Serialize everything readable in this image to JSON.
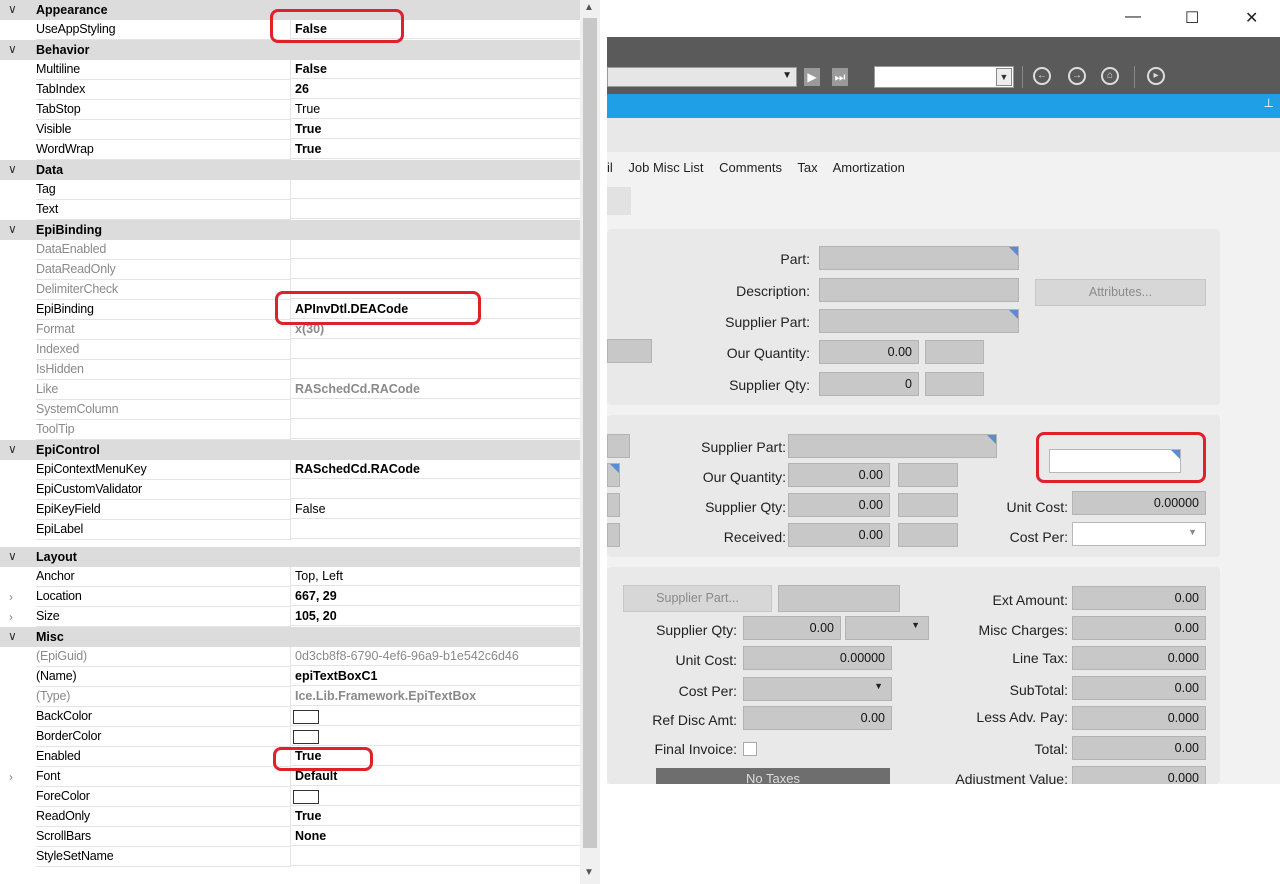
{
  "properties": {
    "appearance": {
      "label": "Appearance",
      "rows": [
        {
          "name": "UseAppStyling",
          "value": "False"
        }
      ]
    },
    "behavior": {
      "label": "Behavior",
      "rows": [
        {
          "name": "Multiline",
          "value": "False"
        },
        {
          "name": "TabIndex",
          "value": "26"
        },
        {
          "name": "TabStop",
          "value": "True"
        },
        {
          "name": "Visible",
          "value": "True"
        },
        {
          "name": "WordWrap",
          "value": "True"
        }
      ]
    },
    "data": {
      "label": "Data",
      "rows": [
        {
          "name": "Tag",
          "value": ""
        },
        {
          "name": "Text",
          "value": ""
        }
      ]
    },
    "epibinding": {
      "label": "EpiBinding",
      "rows": [
        {
          "name": "DataEnabled",
          "value": ""
        },
        {
          "name": "DataReadOnly",
          "value": ""
        },
        {
          "name": "DelimiterCheck",
          "value": ""
        },
        {
          "name": "EpiBinding",
          "value": "APInvDtl.DEACode"
        },
        {
          "name": "Format",
          "value": "x(30)"
        },
        {
          "name": "Indexed",
          "value": ""
        },
        {
          "name": "IsHidden",
          "value": ""
        },
        {
          "name": "Like",
          "value": "RASchedCd.RACode"
        },
        {
          "name": "SystemColumn",
          "value": ""
        },
        {
          "name": "ToolTip",
          "value": ""
        }
      ]
    },
    "epicontrol": {
      "label": "EpiControl",
      "rows": [
        {
          "name": "EpiContextMenuKey",
          "value": "RASchedCd.RACode"
        },
        {
          "name": "EpiCustomValidator",
          "value": ""
        },
        {
          "name": "EpiKeyField",
          "value": "False"
        },
        {
          "name": "EpiLabel",
          "value": ""
        }
      ]
    },
    "layout": {
      "label": "Layout",
      "rows": [
        {
          "name": "Anchor",
          "value": "Top, Left"
        },
        {
          "name": "Location",
          "value": "667, 29"
        },
        {
          "name": "Size",
          "value": "105, 20"
        }
      ]
    },
    "misc": {
      "label": "Misc",
      "rows": [
        {
          "name": "(EpiGuid)",
          "value": "0d3cb8f8-6790-4ef6-96a9-b1e542c6d46"
        },
        {
          "name": "(Name)",
          "value": "epiTextBoxC1"
        },
        {
          "name": "(Type)",
          "value": "Ice.Lib.Framework.EpiTextBox"
        },
        {
          "name": "BackColor",
          "value": ""
        },
        {
          "name": "BorderColor",
          "value": ""
        },
        {
          "name": "Enabled",
          "value": "True"
        },
        {
          "name": "Font",
          "value": "Default"
        },
        {
          "name": "ForeColor",
          "value": ""
        },
        {
          "name": "ReadOnly",
          "value": "True"
        },
        {
          "name": "ScrollBars",
          "value": "None"
        },
        {
          "name": "StyleSetName",
          "value": ""
        }
      ]
    }
  },
  "window": {
    "minimize": "—",
    "maximize": "☐",
    "close": "✕"
  },
  "tabs": [
    "il",
    "Job Misc List",
    "Comments",
    "Tax",
    "Amortization"
  ],
  "panel1": {
    "part_label": "Part:",
    "description_label": "Description:",
    "supplier_part_label": "Supplier Part:",
    "our_quantity_label": "Our Quantity:",
    "our_quantity_value": "0.00",
    "supplier_qty_label": "Supplier Qty:",
    "supplier_qty_value": "0",
    "attributes_button": "Attributes..."
  },
  "panel2": {
    "supplier_part_label": "Supplier Part:",
    "our_quantity_label": "Our Quantity:",
    "our_quantity_value": "0.00",
    "supplier_qty_label": "Supplier Qty:",
    "supplier_qty_value": "0.00",
    "received_label": "Received:",
    "received_value": "0.00",
    "unit_cost_label": "Unit Cost:",
    "unit_cost_value": "0.00000",
    "cost_per_label": "Cost Per:"
  },
  "panel3": {
    "supplier_part_button": "Supplier Part...",
    "supplier_qty_label": "Supplier Qty:",
    "supplier_qty_value": "0.00",
    "unit_cost_label": "Unit Cost:",
    "unit_cost_value": "0.00000",
    "cost_per_label": "Cost Per:",
    "ref_disc_amt_label": "Ref Disc Amt:",
    "ref_disc_amt_value": "0.00",
    "final_invoice_label": "Final Invoice:",
    "no_taxes_button": "No Taxes",
    "ext_amount_label": "Ext Amount:",
    "ext_amount_value": "0.00",
    "misc_charges_label": "Misc Charges:",
    "misc_charges_value": "0.00",
    "line_tax_label": "Line Tax:",
    "line_tax_value": "0.000",
    "subtotal_label": "SubTotal:",
    "subtotal_value": "0.00",
    "less_adv_pay_label": "Less Adv. Pay:",
    "less_adv_pay_value": "0.000",
    "total_label": "Total:",
    "total_value": "0.00",
    "adjustment_value_label": "Adjustment Value:",
    "adjustment_value_value": "0.000"
  },
  "colors": {
    "accent_blue": "#1e9fe6",
    "highlight_red": "#e0202a",
    "toolbar_grey": "#5a5a5a"
  }
}
